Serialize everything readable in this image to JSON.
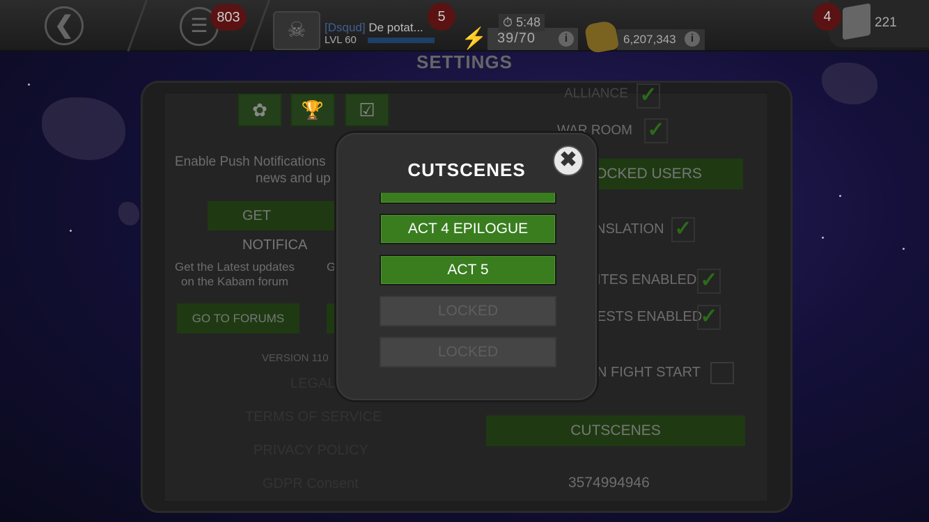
{
  "header": {
    "notifications_count": "803",
    "player": {
      "tag": "[Dsqud]",
      "name": "De potat...",
      "level": "LVL 60"
    },
    "alerts_count": "5",
    "timer": "5:48",
    "energy": "39/70",
    "gold": "6,207,343",
    "crystals_badge": "4",
    "units": "221"
  },
  "page_title": "SETTINGS",
  "settings": {
    "push_text_line1": "Enable Push Notifications",
    "push_text_line2": "news and up",
    "get_notifications_button": "GET NOTIFICA",
    "forum_text_line1": "Get the Latest updates",
    "forum_text_line2": "on the Kabam forum",
    "forum_text_cut": "G",
    "go_to_forums_button": "GO TO FORUMS",
    "version": "VERSION 110",
    "legal_link": "LEGAL",
    "terms_link": "TERMS OF SERVICE",
    "privacy_link": "PRIVACY POLICY",
    "gdpr_link": "GDPR Consent",
    "alliance_label": "ALLIANCE",
    "war_room_label": "WAR ROOM",
    "blocked_users_button": "OCKED USERS",
    "translation_label": "NSLATION",
    "invites_label": "ITES ENABLED",
    "requests_label": "ESTS ENABLED",
    "fight_start_label": "N FIGHT START",
    "cutscenes_button": "CUTSCENES",
    "player_id": "3574994946"
  },
  "modal": {
    "title": "CUTSCENES",
    "items": [
      {
        "label": "",
        "state": "active"
      },
      {
        "label": "ACT 4 EPILOGUE",
        "state": "active"
      },
      {
        "label": "ACT 5",
        "state": "active"
      },
      {
        "label": "LOCKED",
        "state": "locked"
      },
      {
        "label": "LOCKED",
        "state": "locked"
      }
    ]
  },
  "colors": {
    "button_green": "#397d1f",
    "locked_gray": "#454545",
    "modal_bg": "#2f2f2f"
  }
}
